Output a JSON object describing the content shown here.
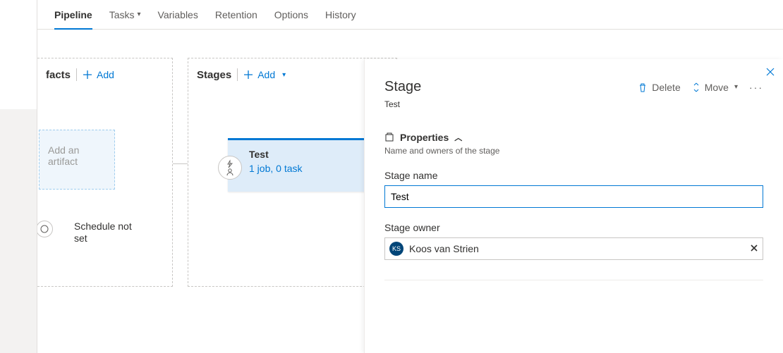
{
  "tabs": {
    "pipeline": "Pipeline",
    "tasks": "Tasks",
    "variables": "Variables",
    "retention": "Retention",
    "options": "Options",
    "history": "History"
  },
  "artifacts": {
    "title": "facts",
    "add_label": "Add",
    "add_artifact_line1": "Add an",
    "add_artifact_line2": "artifact",
    "schedule_line1": "Schedule not",
    "schedule_line2": "set"
  },
  "stages": {
    "title": "Stages",
    "add_label": "Add",
    "card": {
      "name": "Test",
      "subtitle": "1 job, 0 task"
    }
  },
  "panel": {
    "title": "Stage",
    "subtitle": "Test",
    "delete_label": "Delete",
    "move_label": "Move",
    "properties_heading": "Properties",
    "properties_sub": "Name and owners of the stage",
    "stage_name_label": "Stage name",
    "stage_name_value": "Test",
    "stage_owner_label": "Stage owner",
    "owner_initials": "KS",
    "owner_name": "Koos van Strien"
  }
}
